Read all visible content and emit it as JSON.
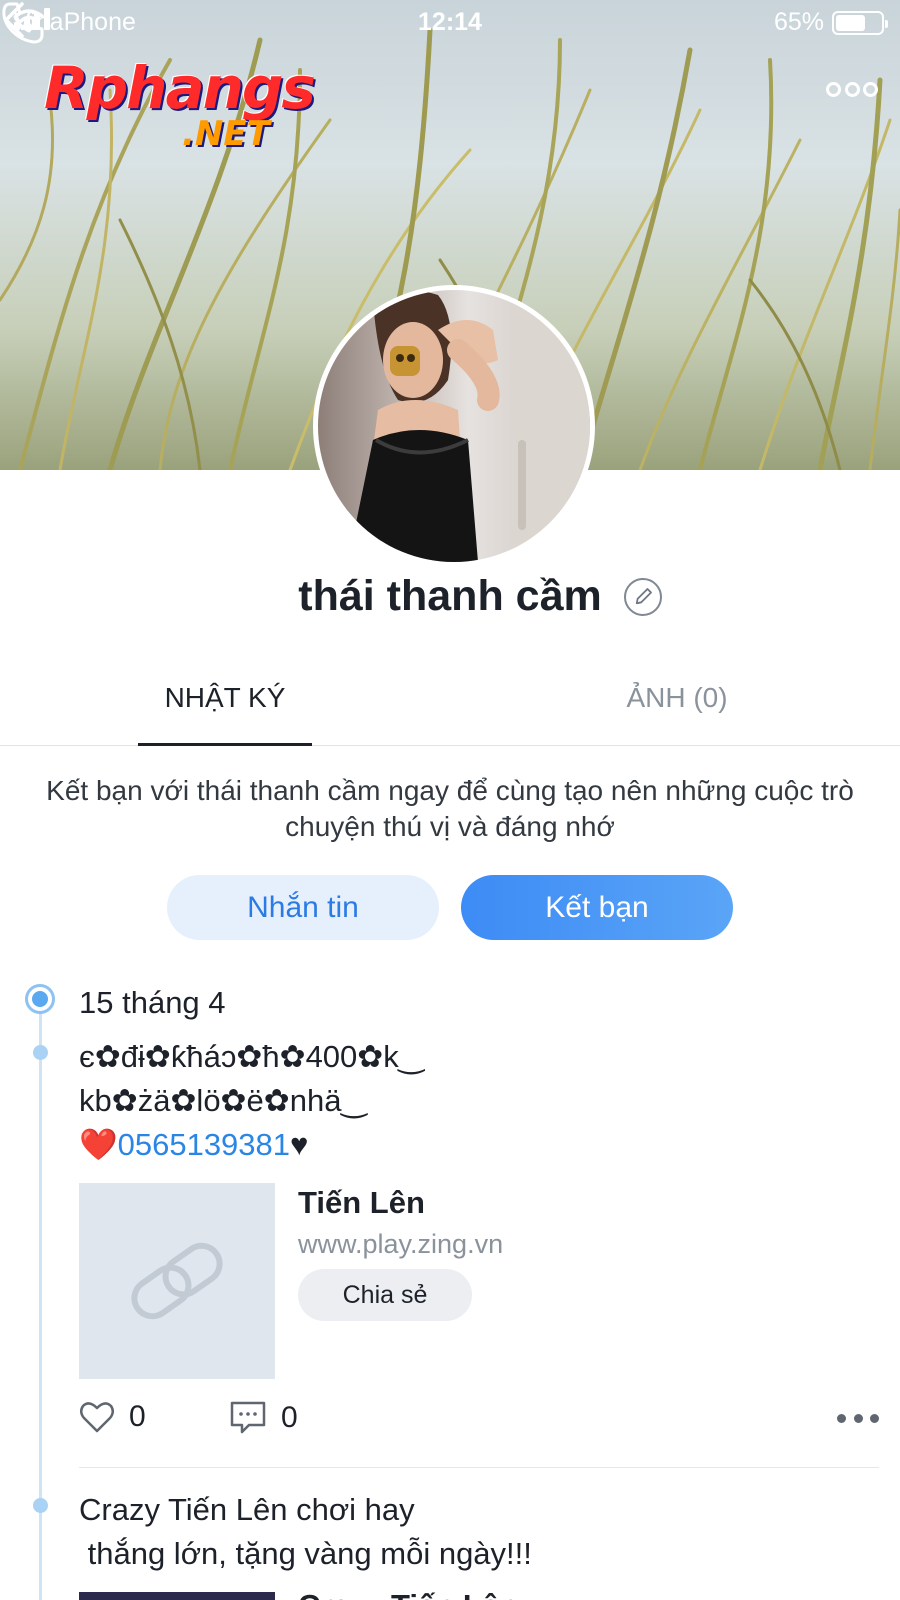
{
  "status_bar": {
    "carrier": "VinaPhone",
    "time": "12:14",
    "battery": "65%",
    "battery_level": 0.65
  },
  "header": {
    "logo_main": "Rphangs",
    "logo_sub": ".NET",
    "icons": {
      "back": "chevron-left-icon",
      "call": "phone-icon",
      "more": "more-horizontal-icon"
    }
  },
  "profile": {
    "name": "thái thanh cầm"
  },
  "tabs": [
    {
      "label": "NHẬT KÝ",
      "active": true
    },
    {
      "label": "ẢNH (0)",
      "active": false
    }
  ],
  "invite": {
    "text": "Kết bạn với thái thanh cầm ngay để cùng tạo nên những cuộc trò chuyện thú vị và đáng nhớ"
  },
  "actions": {
    "message_label": "Nhắn tin",
    "add_friend_label": "Kết bạn"
  },
  "posts": [
    {
      "date": "15 tháng 4",
      "line1": "є✿đɨ✿ƙħáɔ✿ħ✿400✿k‿",
      "line2": "kb✿żä✿lö✿ë✿nhä‿",
      "heart": "❤️",
      "phone": "0565139381",
      "tail": "♥",
      "link": {
        "title": "Tiến Lên",
        "url": "www.play.zing.vn",
        "share_label": "Chia sẻ"
      },
      "likes": "0",
      "comments": "0"
    },
    {
      "text": "Crazy Tiến Lên chơi hay\n thắng lớn, tặng vàng mỗi ngày!!!",
      "link_title_partial": "Crazy Tiến Lên"
    }
  ],
  "colors": {
    "accent": "#3d8bf5",
    "link": "#2a86e6",
    "timeline": "#a9d2f5"
  }
}
